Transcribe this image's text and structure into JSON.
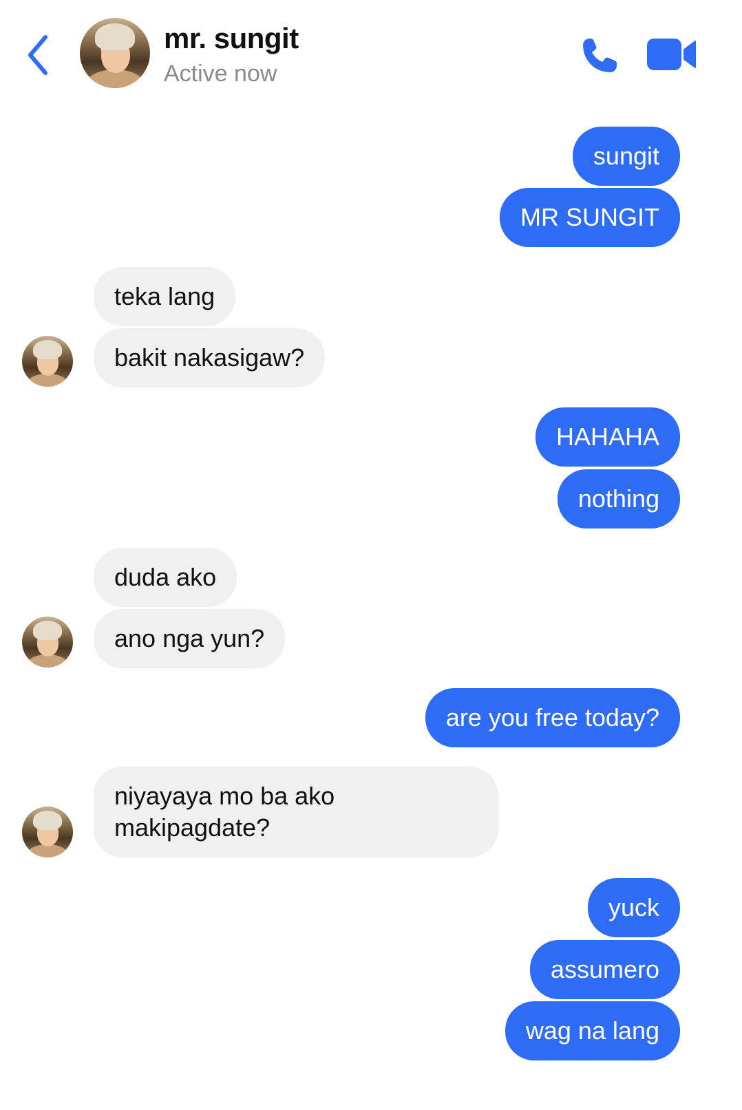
{
  "header": {
    "contact_name": "mr. sungit",
    "status": "Active now",
    "icons": {
      "back": "chevron-left-icon",
      "call": "phone-icon",
      "video": "video-camera-icon"
    },
    "accent_color": "#2e6cf6"
  },
  "messages": [
    {
      "from": "me",
      "text": "sungit"
    },
    {
      "from": "me",
      "text": "MR SUNGIT"
    },
    {
      "from": "them",
      "text": "teka lang"
    },
    {
      "from": "them",
      "text": "bakit nakasigaw?"
    },
    {
      "from": "me",
      "text": "HAHAHA"
    },
    {
      "from": "me",
      "text": "nothing"
    },
    {
      "from": "them",
      "text": "duda ako"
    },
    {
      "from": "them",
      "text": "ano nga yun?"
    },
    {
      "from": "me",
      "text": "are you free today?"
    },
    {
      "from": "them",
      "text": "niyayaya mo ba ako makipagdate?"
    },
    {
      "from": "me",
      "text": "yuck"
    },
    {
      "from": "me",
      "text": "assumero"
    },
    {
      "from": "me",
      "text": "wag na lang"
    }
  ],
  "colors": {
    "sent_bubble": "#2e6cf6",
    "received_bubble": "#f0f0f0"
  }
}
